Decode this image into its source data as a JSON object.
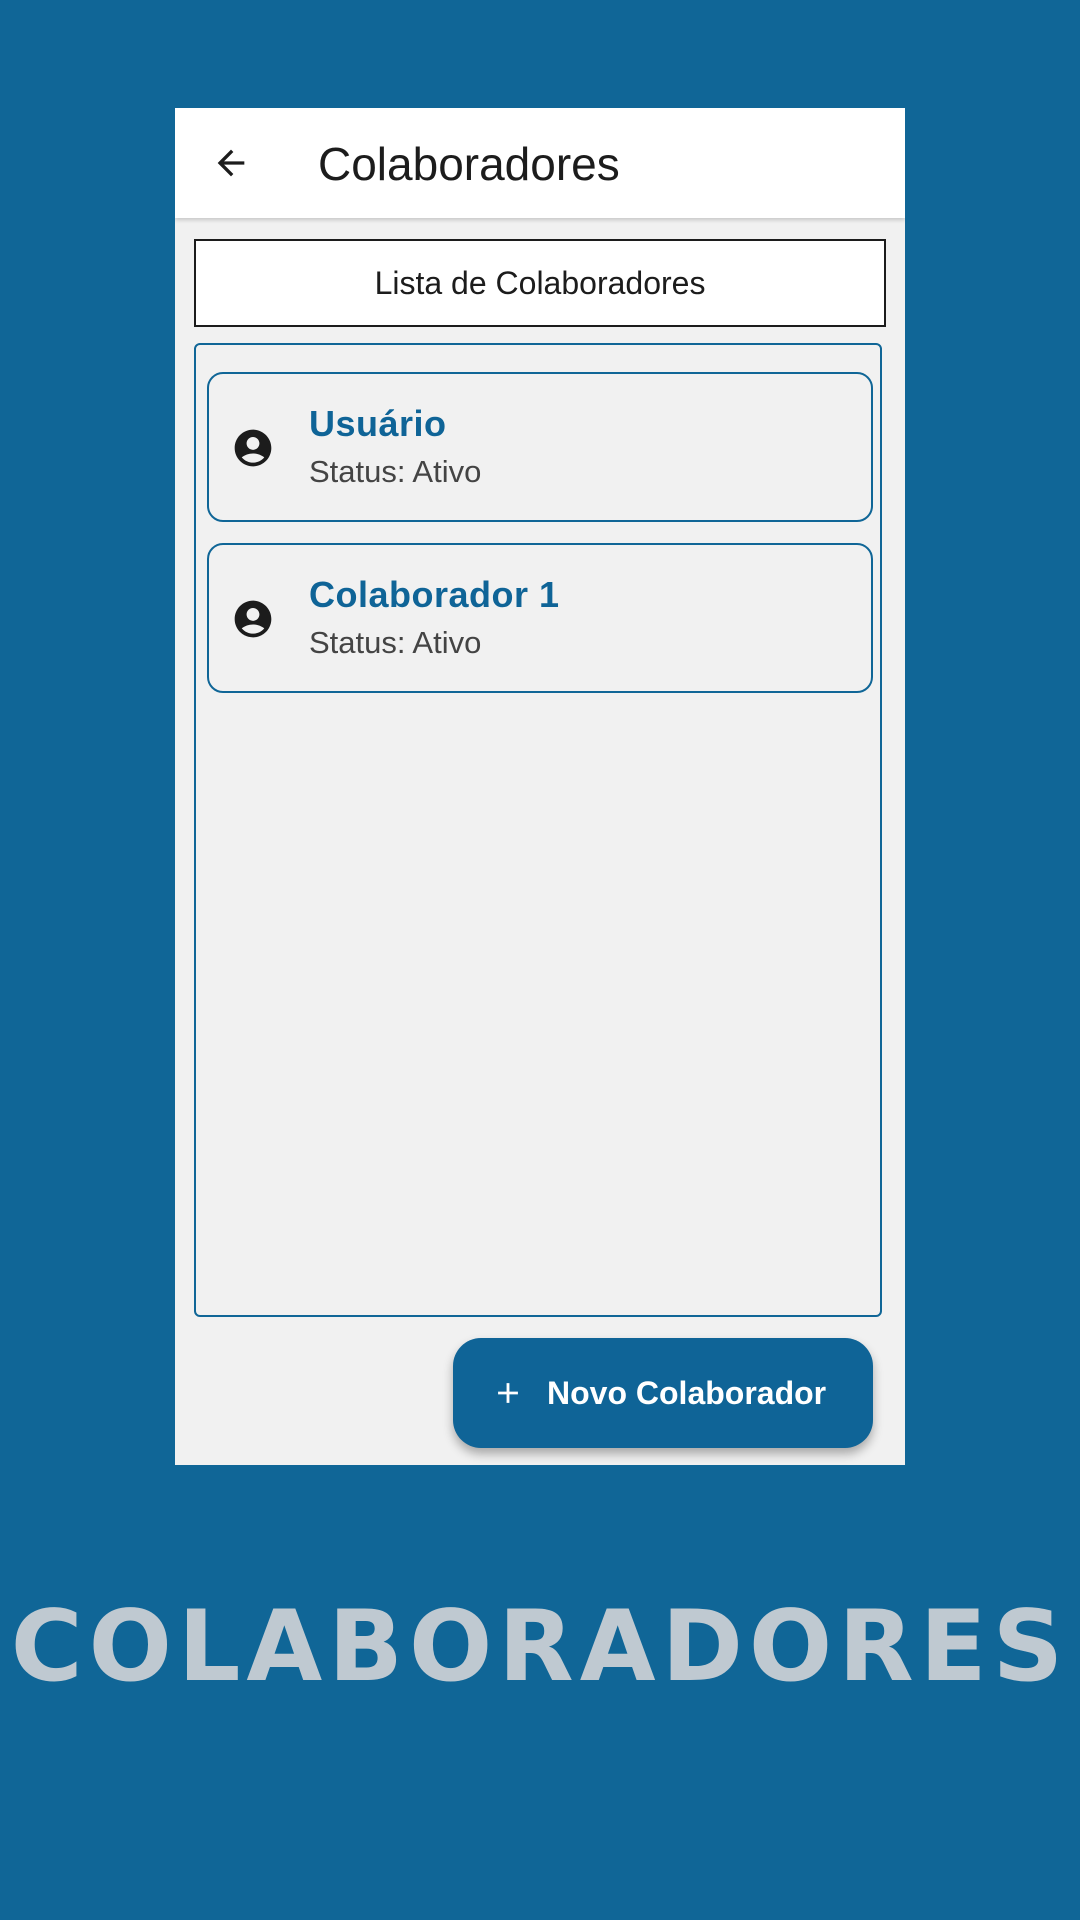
{
  "appbar": {
    "title": "Colaboradores",
    "back_icon": "arrow-back-icon"
  },
  "list": {
    "header": "Lista de Colaboradores",
    "items": [
      {
        "name": "Usuário",
        "status": "Status: Ativo",
        "icon": "account-circle-icon"
      },
      {
        "name": "Colaborador 1",
        "status": "Status: Ativo",
        "icon": "account-circle-icon"
      }
    ]
  },
  "fab": {
    "label": "Novo Colaborador",
    "icon": "plus-icon"
  },
  "promo": {
    "title": "COLABORADORES"
  },
  "colors": {
    "background": "#106697",
    "accent": "#0f6497",
    "surface": "#f1f1f1",
    "promo_text": "#bfc9d1"
  }
}
